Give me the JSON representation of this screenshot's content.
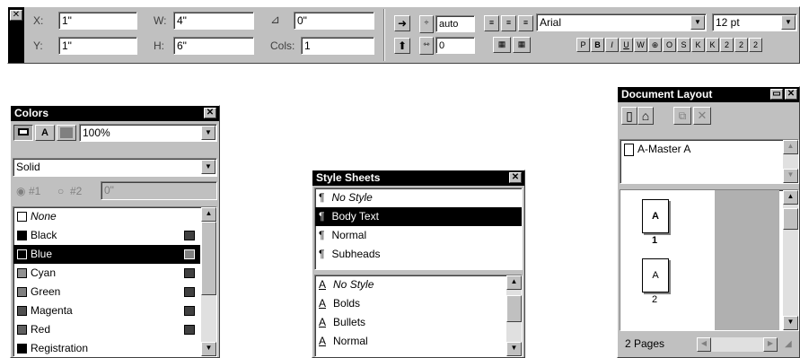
{
  "measurements": {
    "x_label": "X:",
    "x_value": "1\"",
    "y_label": "Y:",
    "y_value": "1\"",
    "w_label": "W:",
    "w_value": "4\"",
    "h_label": "H:",
    "h_value": "6\"",
    "angle_value": "0\"",
    "cols_label": "Cols:",
    "cols_value": "1",
    "leading_value": "auto",
    "tracking_value": "0",
    "font_value": "Arial",
    "size_value": "12 pt",
    "style_buttons": [
      "P",
      "B",
      "I",
      "U",
      "W",
      "⊕",
      "O",
      "S",
      "K",
      "K",
      "2",
      "2",
      "2"
    ]
  },
  "colors": {
    "title": "Colors",
    "shade": "100%",
    "fill_style": "Solid",
    "blend_1": "#1",
    "blend_2": "#2",
    "angle": "0\"",
    "items": [
      {
        "name": "None",
        "hex": "#ffffff",
        "italic": true,
        "selected": false
      },
      {
        "name": "Black",
        "hex": "#000000",
        "italic": false,
        "selected": false
      },
      {
        "name": "Blue",
        "hex": "#000080",
        "italic": false,
        "selected": true
      },
      {
        "name": "Cyan",
        "hex": "#00a0c0",
        "italic": false,
        "selected": false
      },
      {
        "name": "Green",
        "hex": "#00a000",
        "italic": false,
        "selected": false
      },
      {
        "name": "Magenta",
        "hex": "#c000a0",
        "italic": false,
        "selected": false
      },
      {
        "name": "Red",
        "hex": "#c00000",
        "italic": false,
        "selected": false
      },
      {
        "name": "Registration",
        "hex": "#000000",
        "italic": false,
        "selected": false
      }
    ]
  },
  "style_sheets": {
    "title": "Style Sheets",
    "paragraph_styles": [
      "No Style",
      "Body Text",
      "Normal",
      "Subheads"
    ],
    "selected_paragraph": 1,
    "character_styles": [
      "No Style",
      "Bolds",
      "Bullets",
      "Normal"
    ]
  },
  "document_layout": {
    "title": "Document Layout",
    "master": "A-Master A",
    "pages": [
      {
        "master": "A",
        "number": "1"
      },
      {
        "master": "A",
        "number": "2"
      }
    ],
    "page_count": "2 Pages"
  },
  "accent": "#000000"
}
